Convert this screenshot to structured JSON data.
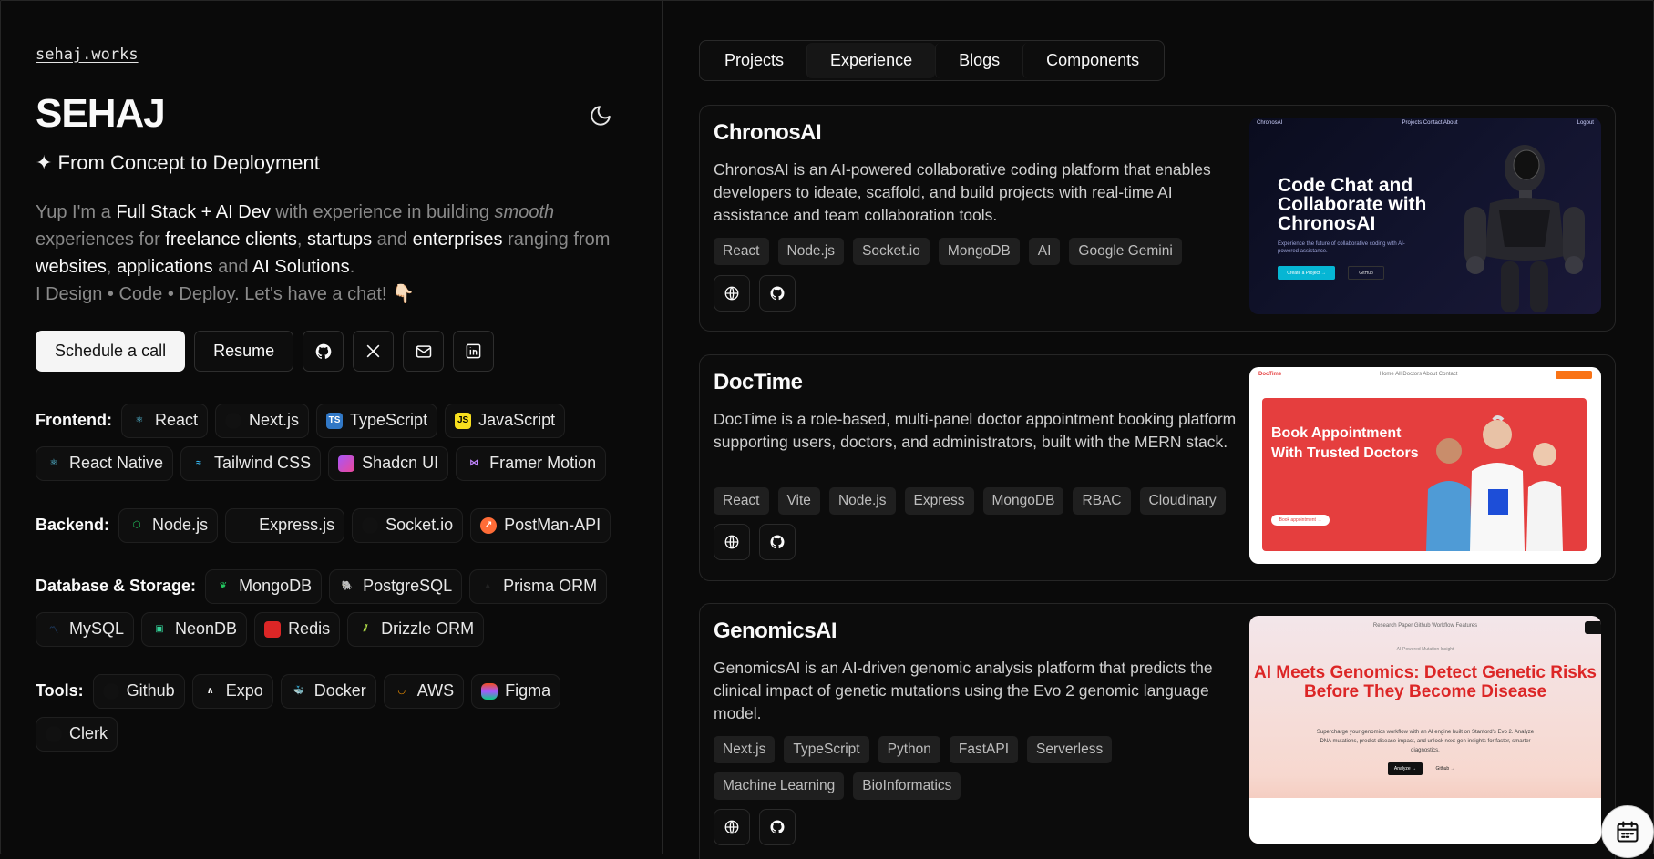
{
  "header": {
    "site": "sehaj.works",
    "name": "SEHAJ",
    "tagline": "✦ From Concept to Deployment"
  },
  "intro": {
    "p1": "Yup I'm a ",
    "h1": "Full Stack + AI Dev",
    "p2": " with experience in building ",
    "em1": "smooth",
    "p3": " experiences for ",
    "h2": "freelance clients",
    "p4": ", ",
    "h3": "startups",
    "p5": " and ",
    "h4": "enterprises",
    "p6": " ranging from ",
    "h5": "websites",
    "p7": ", ",
    "h6": "applications",
    "p8": " and ",
    "h7": "AI Solutions",
    "p9": ".",
    "line2": "I Design • Code • Deploy. Let's have a chat! 👇🏻"
  },
  "actions": {
    "schedule": "Schedule a call",
    "resume": "Resume"
  },
  "skills": {
    "frontend": {
      "label": "Frontend:",
      "items": [
        "React",
        "Next.js",
        "TypeScript",
        "JavaScript",
        "React Native",
        "Tailwind CSS",
        "Shadcn UI",
        "Framer Motion"
      ]
    },
    "backend": {
      "label": "Backend:",
      "items": [
        "Node.js",
        "Express.js",
        "Socket.io",
        "PostMan-API"
      ]
    },
    "database": {
      "label": "Database & Storage:",
      "items": [
        "MongoDB",
        "PostgreSQL",
        "Prisma ORM",
        "MySQL",
        "NeonDB",
        "Redis",
        "Drizzle ORM"
      ]
    },
    "tools": {
      "label": "Tools:",
      "items": [
        "Github",
        "Expo",
        "Docker",
        "AWS",
        "Figma",
        "Clerk"
      ]
    }
  },
  "tabs": [
    "Projects",
    "Experience",
    "Blogs",
    "Components"
  ],
  "projects": [
    {
      "title": "ChronosAI",
      "description": "ChronosAI is an AI-powered collaborative coding platform that enables developers to ideate, scaffold, and build projects with real-time AI assistance and team collaboration tools.",
      "tags": [
        "React",
        "Node.js",
        "Socket.io",
        "MongoDB",
        "AI",
        "Google Gemini"
      ],
      "preview": {
        "brand": "ChronosAI",
        "nav": "Projects   Contact   About",
        "right": "Logout",
        "headline": "Code Chat and Collaborate with ChronosAI",
        "sub": "Experience the future of collaborative coding with AI-powered assistance.",
        "cta": "Create a Project →",
        "cta2": "GitHub"
      }
    },
    {
      "title": "DocTime",
      "description": "DocTime is a role-based, multi-panel doctor appointment booking platform supporting users, doctors, and administrators, built with the MERN stack.",
      "tags": [
        "React",
        "Vite",
        "Node.js",
        "Express",
        "MongoDB",
        "RBAC",
        "Cloudinary"
      ],
      "preview": {
        "brand": "DocTime",
        "nav": "Home   All Doctors   About   Contact",
        "headline": "Book Appointment With Trusted Doctors",
        "cta": "Book appointment →"
      }
    },
    {
      "title": "GenomicsAI",
      "description": "GenomicsAI is an AI-driven genomic analysis platform that predicts the clinical impact of genetic mutations using the Evo 2 genomic language model.",
      "tags": [
        "Next.js",
        "TypeScript",
        "Python",
        "FastAPI",
        "Serverless",
        "Machine Learning",
        "BioInformatics"
      ],
      "preview": {
        "nav": "Research Paper    Github    Workflow    Features",
        "badge": "AI-Powered Mutation Insight",
        "headline": "AI Meets Genomics: Detect Genetic Risks Before They Become Disease",
        "sub": "Supercharge your genomics workflow with an AI engine built on Stanford's Evo 2. Analyze DNA mutations, predict disease impact, and unlock next-gen insights for faster, smarter diagnostics.",
        "cta": "Analyze →",
        "cta2": "Github →"
      }
    }
  ],
  "colors": {
    "bg": "#0a0a0a",
    "accent_red": "#e53e3e",
    "accent_cyan": "#06b6d4"
  }
}
